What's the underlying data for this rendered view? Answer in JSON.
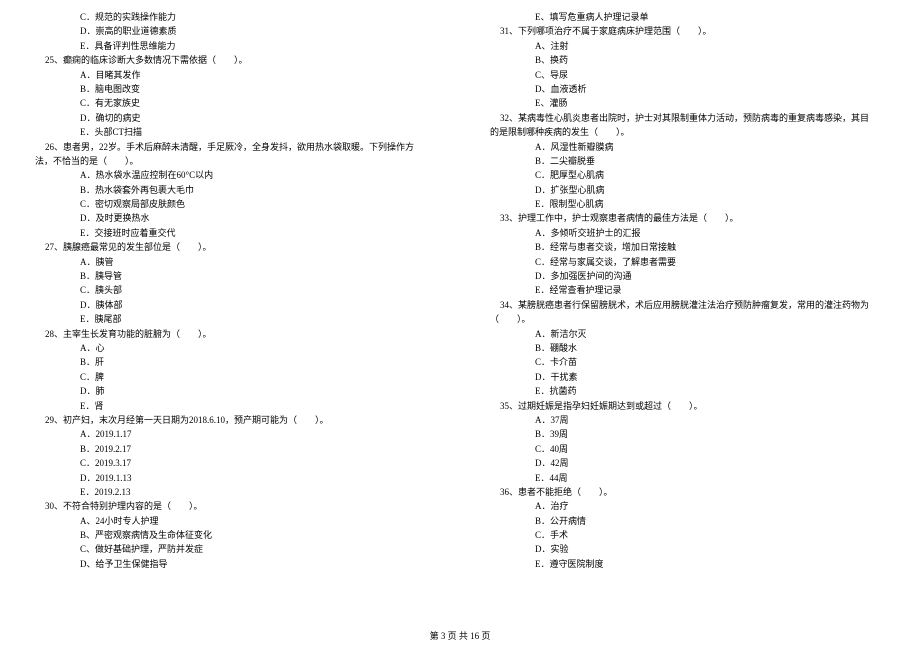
{
  "left_col": [
    {
      "type": "option",
      "text": "C．规范的实践操作能力"
    },
    {
      "type": "option",
      "text": "D．崇高的职业道德素质"
    },
    {
      "type": "option",
      "text": "E．具备评判性思维能力"
    },
    {
      "type": "question",
      "text": "25、癫痫的临床诊断大多数情况下需依据（　　）。"
    },
    {
      "type": "option",
      "text": "A．目睹其发作"
    },
    {
      "type": "option",
      "text": "B．脑电图改变"
    },
    {
      "type": "option",
      "text": "C．有无家族史"
    },
    {
      "type": "option",
      "text": "D．确切的病史"
    },
    {
      "type": "option",
      "text": "E．头部CT扫描"
    },
    {
      "type": "question",
      "text": "26、患者男，22岁。手术后麻醉未清醒，手足厥冷，全身发抖，欲用热水袋取暖。下列操作方"
    },
    {
      "type": "question-cont",
      "text": "法，不恰当的是（　　）。"
    },
    {
      "type": "option",
      "text": "A．热水袋水温应控制在60°C以内"
    },
    {
      "type": "option",
      "text": "B．热水袋套外再包裹大毛巾"
    },
    {
      "type": "option",
      "text": "C．密切观察局部皮肤颜色"
    },
    {
      "type": "option",
      "text": "D．及时更换热水"
    },
    {
      "type": "option",
      "text": "E．交接班时应着重交代"
    },
    {
      "type": "question",
      "text": "27、胰腺癌最常见的发生部位是（　　）。"
    },
    {
      "type": "option",
      "text": "A．胰管"
    },
    {
      "type": "option",
      "text": "B．胰导管"
    },
    {
      "type": "option",
      "text": "C．胰头部"
    },
    {
      "type": "option",
      "text": "D．胰体部"
    },
    {
      "type": "option",
      "text": "E．胰尾部"
    },
    {
      "type": "question",
      "text": "28、主宰生长发育功能的脏腑为（　　）。"
    },
    {
      "type": "option",
      "text": "A．心"
    },
    {
      "type": "option",
      "text": "B．肝"
    },
    {
      "type": "option",
      "text": "C．脾"
    },
    {
      "type": "option",
      "text": "D．肺"
    },
    {
      "type": "option",
      "text": "E．肾"
    },
    {
      "type": "question",
      "text": "29、初产妇，末次月经第一天日期为2018.6.10，预产期可能为（　　）。"
    },
    {
      "type": "option",
      "text": "A．2019.1.17"
    },
    {
      "type": "option",
      "text": "B．2019.2.17"
    },
    {
      "type": "option",
      "text": "C．2019.3.17"
    },
    {
      "type": "option",
      "text": "D．2019.1.13"
    },
    {
      "type": "option",
      "text": "E．2019.2.13"
    },
    {
      "type": "question",
      "text": "30、不符合特别护理内容的是（　　）。"
    },
    {
      "type": "option",
      "text": "A、24小时专人护理"
    },
    {
      "type": "option",
      "text": "B、严密观察病情及生命体征变化"
    },
    {
      "type": "option",
      "text": "C、做好基础护理，严防并发症"
    },
    {
      "type": "option",
      "text": "D、给予卫生保健指导"
    }
  ],
  "right_col": [
    {
      "type": "option",
      "text": "E、填写危重病人护理记录单"
    },
    {
      "type": "question",
      "text": "31、下列哪项治疗不属于家庭病床护理范围（　　）。"
    },
    {
      "type": "option",
      "text": "A、注射"
    },
    {
      "type": "option",
      "text": "B、换药"
    },
    {
      "type": "option",
      "text": "C、导尿"
    },
    {
      "type": "option",
      "text": "D、血液透析"
    },
    {
      "type": "option",
      "text": "E、灌肠"
    },
    {
      "type": "question",
      "text": "32、某病毒性心肌炎患者出院时，护士对其限制重体力活动，预防病毒的重复病毒感染，其目"
    },
    {
      "type": "question-cont",
      "text": "的是限制哪种疾病的发生（　　）。"
    },
    {
      "type": "option",
      "text": "A．风湿性新瓣膜病"
    },
    {
      "type": "option",
      "text": "B．二尖瓣脱垂"
    },
    {
      "type": "option",
      "text": "C．肥厚型心肌病"
    },
    {
      "type": "option",
      "text": "D．扩张型心肌病"
    },
    {
      "type": "option",
      "text": "E．限制型心肌病"
    },
    {
      "type": "question",
      "text": "33、护理工作中，护士观察患者病情的最佳方法是（　　）。"
    },
    {
      "type": "option",
      "text": "A．多倾听交班护士的汇报"
    },
    {
      "type": "option",
      "text": "B．经常与患者交谈，增加日常接触"
    },
    {
      "type": "option",
      "text": "C．经常与家属交谈，了解患者需要"
    },
    {
      "type": "option",
      "text": "D．多加强医护间的沟通"
    },
    {
      "type": "option",
      "text": "E．经常查看护理记录"
    },
    {
      "type": "question",
      "text": "34、某膀胱癌患者行保留膀胱术，术后应用膀胱灌注法治疗预防肿瘤复发，常用的灌注药物为"
    },
    {
      "type": "question-cont",
      "text": "（　　）。"
    },
    {
      "type": "option",
      "text": "A．新洁尔灭"
    },
    {
      "type": "option",
      "text": "B．硼酸水"
    },
    {
      "type": "option",
      "text": "C．卡介苗"
    },
    {
      "type": "option",
      "text": "D．干扰素"
    },
    {
      "type": "option",
      "text": "E．抗菌药"
    },
    {
      "type": "question",
      "text": "35、过期妊娠是指孕妇妊娠期达到或超过（　　）。"
    },
    {
      "type": "option",
      "text": "A．37周"
    },
    {
      "type": "option",
      "text": "B．39周"
    },
    {
      "type": "option",
      "text": "C．40周"
    },
    {
      "type": "option",
      "text": "D．42周"
    },
    {
      "type": "option",
      "text": "E．44周"
    },
    {
      "type": "question",
      "text": "36、患者不能拒绝（　　）。"
    },
    {
      "type": "option",
      "text": "A．治疗"
    },
    {
      "type": "option",
      "text": "B．公开病情"
    },
    {
      "type": "option",
      "text": "C．手术"
    },
    {
      "type": "option",
      "text": "D．实验"
    },
    {
      "type": "option",
      "text": "E．遵守医院制度"
    }
  ],
  "footer": "第 3 页 共 16 页"
}
